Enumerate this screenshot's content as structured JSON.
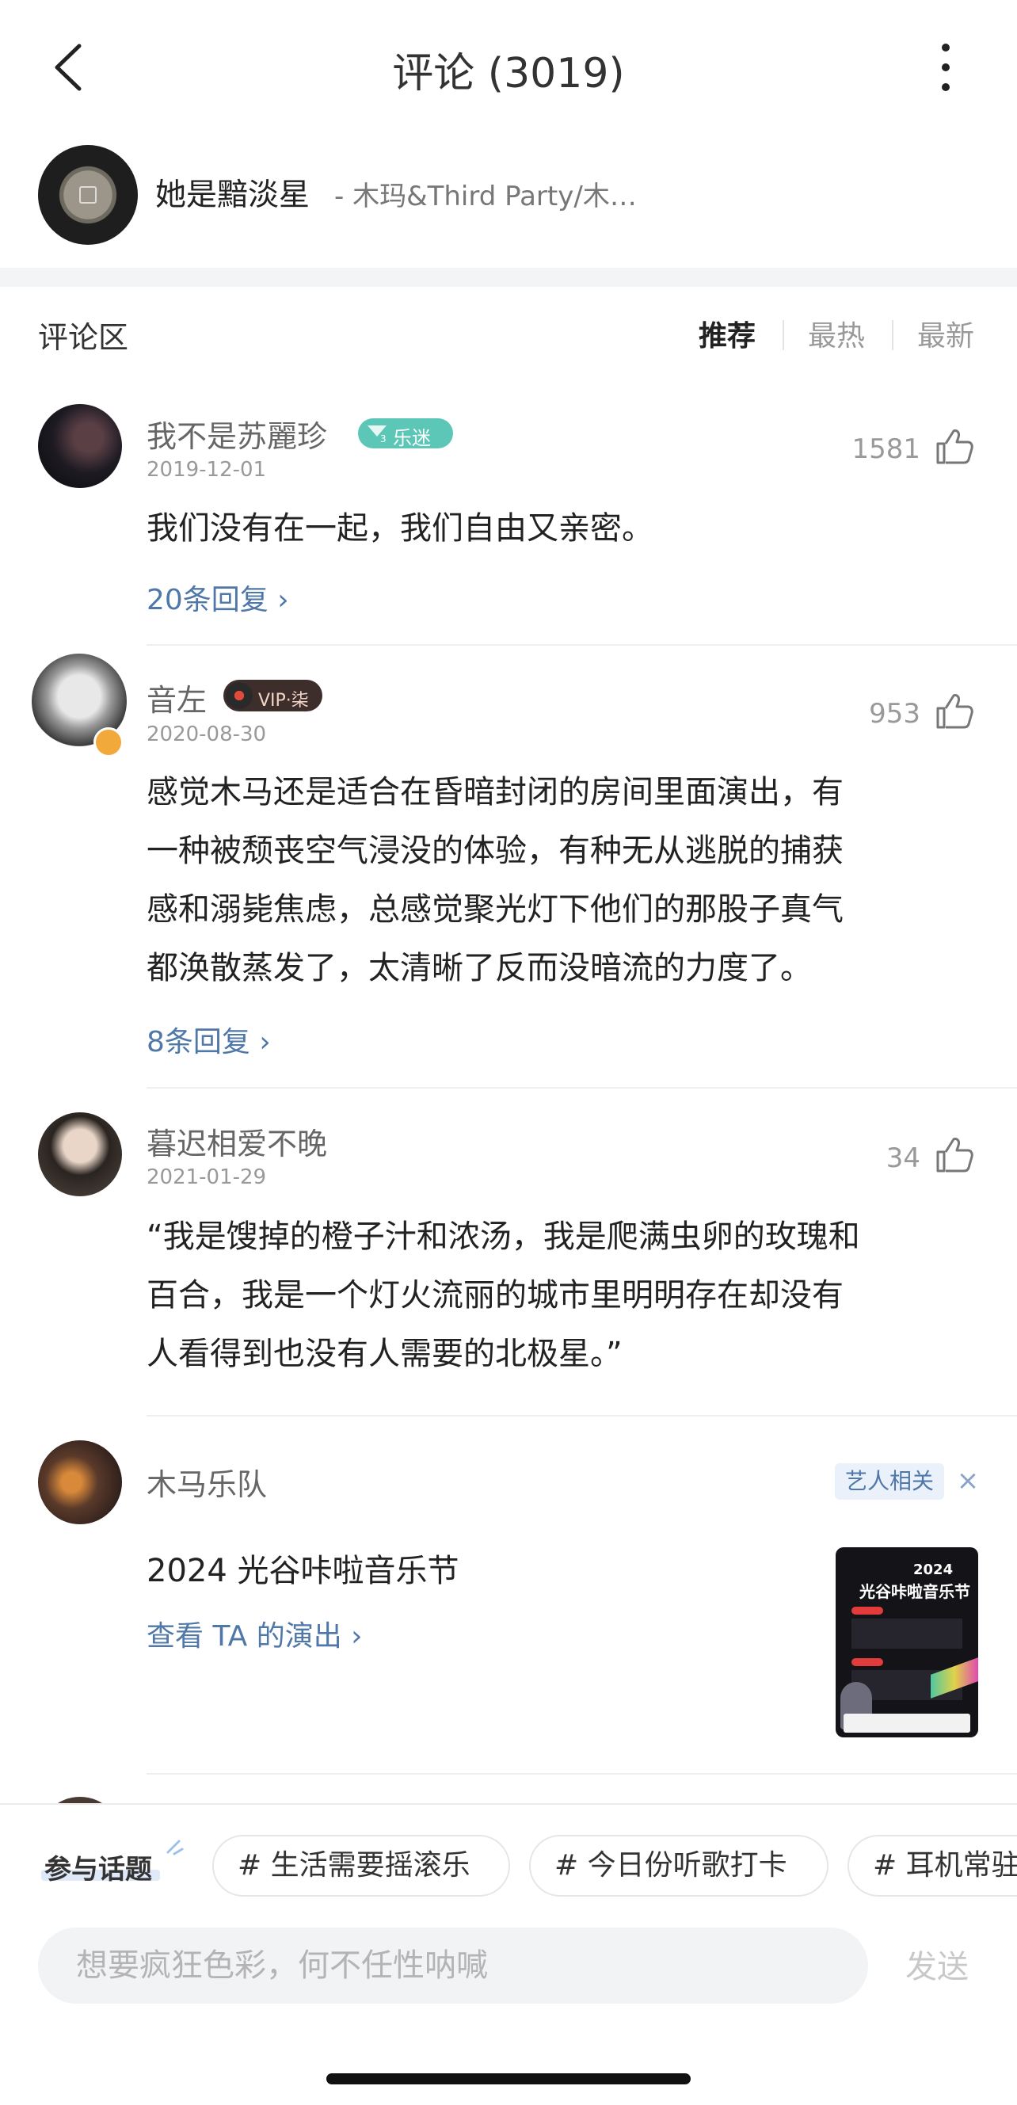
{
  "header": {
    "title": "评论 (3019)",
    "back_icon": "chevron-left-icon",
    "more_icon": "more-vertical-icon"
  },
  "song": {
    "name": "她是黯淡星",
    "artist": "- 木玛&Third Party/木…"
  },
  "comments_section": {
    "title": "评论区",
    "sort_options": [
      "推荐",
      "最热",
      "最新"
    ],
    "active_sort": "推荐"
  },
  "comments": [
    {
      "user": "我不是苏麗珍",
      "badge": "乐迷",
      "badge_level": "3",
      "date": "2019-12-01",
      "likes": "1581",
      "text": "我们没有在一起，我们自由又亲密。",
      "replies": "20条回复"
    },
    {
      "user": "音左",
      "badge": "VIP·柒",
      "date": "2020-08-30",
      "likes": "953",
      "text_lines": [
        "感觉木马还是适合在昏暗封闭的房间里面演出，有",
        "一种被颓丧空气浸没的体验，有种无从逃脱的捕获",
        "感和溺毙焦虑，总感觉聚光灯下他们的那股子真气",
        "都涣散蒸发了，太清晰了反而没暗流的力度了。"
      ],
      "replies": "8条回复"
    },
    {
      "user": "暮迟相爱不晚",
      "date": "2021-01-29",
      "likes": "34",
      "text_lines": [
        "“我是馊掉的橙子汁和浓汤，我是爬满虫卵的玫瑰和",
        "百合，我是一个灯火流丽的城市里明明存在却没有",
        "人看得到也没有人需要的北极星。”"
      ]
    }
  ],
  "artist_promo": {
    "name": "木马乐队",
    "tag": "艺人相关",
    "event": "2024 光谷咔啦音乐节",
    "link": "查看 TA 的演出",
    "poster": {
      "year": "2024",
      "title": "光谷咔啦音乐节"
    }
  },
  "topics": {
    "label": "参与话题",
    "chips": [
      "# 生活需要摇滚乐",
      "# 今日份听歌打卡",
      "# 耳机常驻"
    ]
  },
  "input": {
    "placeholder": "想要疯狂色彩，何不任性呐喊",
    "send_label": "发送"
  },
  "colors": {
    "link": "#4f78a8",
    "fan_badge": "#5cc7b7",
    "vip_badge": "#3d2e2c",
    "divider": "#f3f4f6"
  }
}
